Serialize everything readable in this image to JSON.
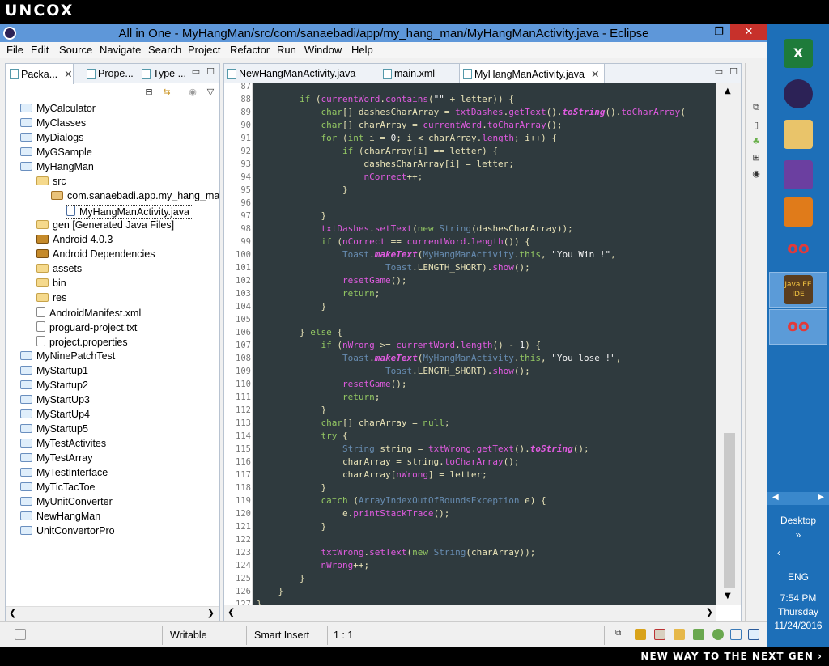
{
  "overlay": {
    "brand": "UNCOX",
    "slogan": "NEW WAY TO THE NEXT GEN ›"
  },
  "window": {
    "title": "All in One - MyHangMan/src/com/sanaebadi/app/my_hang_man/MyHangManActivity.java - Eclipse",
    "minimize": "–",
    "maximize": "❐",
    "close": "✕"
  },
  "menu": [
    "File",
    "Edit",
    "Source",
    "Navigate",
    "Search",
    "Project",
    "Refactor",
    "Run",
    "Window",
    "Help"
  ],
  "left_tabs": [
    "Packa...",
    "Prope...",
    "Type ..."
  ],
  "tree": [
    "MyCalculator",
    "MyClasses",
    "MyDialogs",
    "MyGSample",
    "MyHangMan",
    "src",
    "com.sanaebadi.app.my_hang_man",
    "MyHangManActivity.java",
    "gen [Generated Java Files]",
    "Android 4.0.3",
    "Android Dependencies",
    "assets",
    "bin",
    "res",
    "AndroidManifest.xml",
    "proguard-project.txt",
    "project.properties",
    "MyNinePatchTest",
    "MyStartup1",
    "MyStartup2",
    "MyStartUp3",
    "MyStartUp4",
    "MyStartup5",
    "MyTestActivites",
    "MyTestArray",
    "MyTestInterface",
    "MyTicTacToe",
    "MyUnitConverter",
    "NewHangMan",
    "UnitConvertorPro"
  ],
  "editor_tabs": [
    "NewHangManActivity.java",
    "main.xml",
    "MyHangManActivity.java"
  ],
  "line_numbers": [
    "87",
    "88",
    "89",
    "90",
    "91",
    "92",
    "93",
    "94",
    "95",
    "96",
    "97",
    "98",
    "99",
    "100",
    "101",
    "102",
    "103",
    "104",
    "105",
    "106",
    "107",
    "108",
    "109",
    "110",
    "111",
    "112",
    "113",
    "114",
    "115",
    "116",
    "117",
    "118",
    "119",
    "120",
    "121",
    "122",
    "123",
    "124",
    "125",
    "126",
    "127"
  ],
  "status": {
    "writable": "Writable",
    "insert": "Smart Insert",
    "position": "1 : 1"
  },
  "taskbar": {
    "desktop": "Desktop",
    "lang": "ENG",
    "time": "7:54 PM",
    "day": "Thursday",
    "date": "11/24/2016",
    "javaee": "Java EE IDE"
  }
}
